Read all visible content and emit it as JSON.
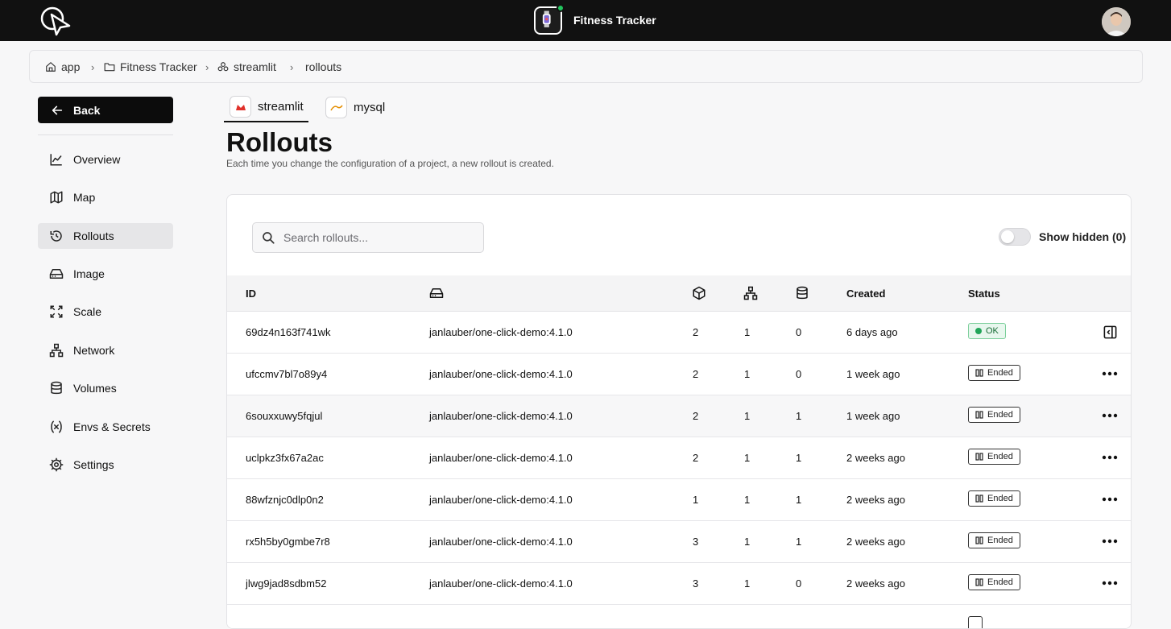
{
  "header": {
    "app_title": "Fitness Tracker"
  },
  "breadcrumb": {
    "app": "app",
    "project": "Fitness Tracker",
    "service": "streamlit",
    "page": "rollouts"
  },
  "sidebar": {
    "back_label": "Back",
    "items": [
      {
        "label": "Overview",
        "icon": "chart-line-icon"
      },
      {
        "label": "Map",
        "icon": "map-icon"
      },
      {
        "label": "Rollouts",
        "icon": "history-icon",
        "active": true
      },
      {
        "label": "Image",
        "icon": "hard-drive-icon"
      },
      {
        "label": "Scale",
        "icon": "scale-icon"
      },
      {
        "label": "Network",
        "icon": "network-icon"
      },
      {
        "label": "Volumes",
        "icon": "database-icon"
      },
      {
        "label": "Envs & Secrets",
        "icon": "variable-icon"
      },
      {
        "label": "Settings",
        "icon": "gear-icon"
      }
    ]
  },
  "tabs": [
    {
      "label": "streamlit"
    },
    {
      "label": "mysql"
    }
  ],
  "page": {
    "title": "Rollouts",
    "subtitle": "Each time you change the configuration of a project, a new rollout is created."
  },
  "search": {
    "placeholder": "Search rollouts..."
  },
  "toggle": {
    "label": "Show hidden (0)"
  },
  "table": {
    "headers": {
      "id": "ID",
      "created": "Created",
      "status": "Status"
    },
    "rows": [
      {
        "id": "69dz4n163f741wk",
        "image": "janlauber/one-click-demo:4.1.0",
        "replicas": "2",
        "network": "1",
        "volumes": "0",
        "created": "6 days ago",
        "status": "OK"
      },
      {
        "id": "ufccmv7bl7o89y4",
        "image": "janlauber/one-click-demo:4.1.0",
        "replicas": "2",
        "network": "1",
        "volumes": "0",
        "created": "1 week ago",
        "status": "Ended"
      },
      {
        "id": "6souxxuwy5fqjul",
        "image": "janlauber/one-click-demo:4.1.0",
        "replicas": "2",
        "network": "1",
        "volumes": "1",
        "created": "1 week ago",
        "status": "Ended"
      },
      {
        "id": "uclpkz3fx67a2ac",
        "image": "janlauber/one-click-demo:4.1.0",
        "replicas": "2",
        "network": "1",
        "volumes": "1",
        "created": "2 weeks ago",
        "status": "Ended"
      },
      {
        "id": "88wfznjc0dlp0n2",
        "image": "janlauber/one-click-demo:4.1.0",
        "replicas": "1",
        "network": "1",
        "volumes": "1",
        "created": "2 weeks ago",
        "status": "Ended"
      },
      {
        "id": "rx5h5by0gmbe7r8",
        "image": "janlauber/one-click-demo:4.1.0",
        "replicas": "3",
        "network": "1",
        "volumes": "1",
        "created": "2 weeks ago",
        "status": "Ended"
      },
      {
        "id": "jlwg9jad8sdbm52",
        "image": "janlauber/one-click-demo:4.1.0",
        "replicas": "3",
        "network": "1",
        "volumes": "0",
        "created": "2 weeks ago",
        "status": "Ended"
      }
    ]
  },
  "colors": {
    "topbar": "#111111",
    "ok_green": "#22a559",
    "online_dot": "#22c55e"
  }
}
